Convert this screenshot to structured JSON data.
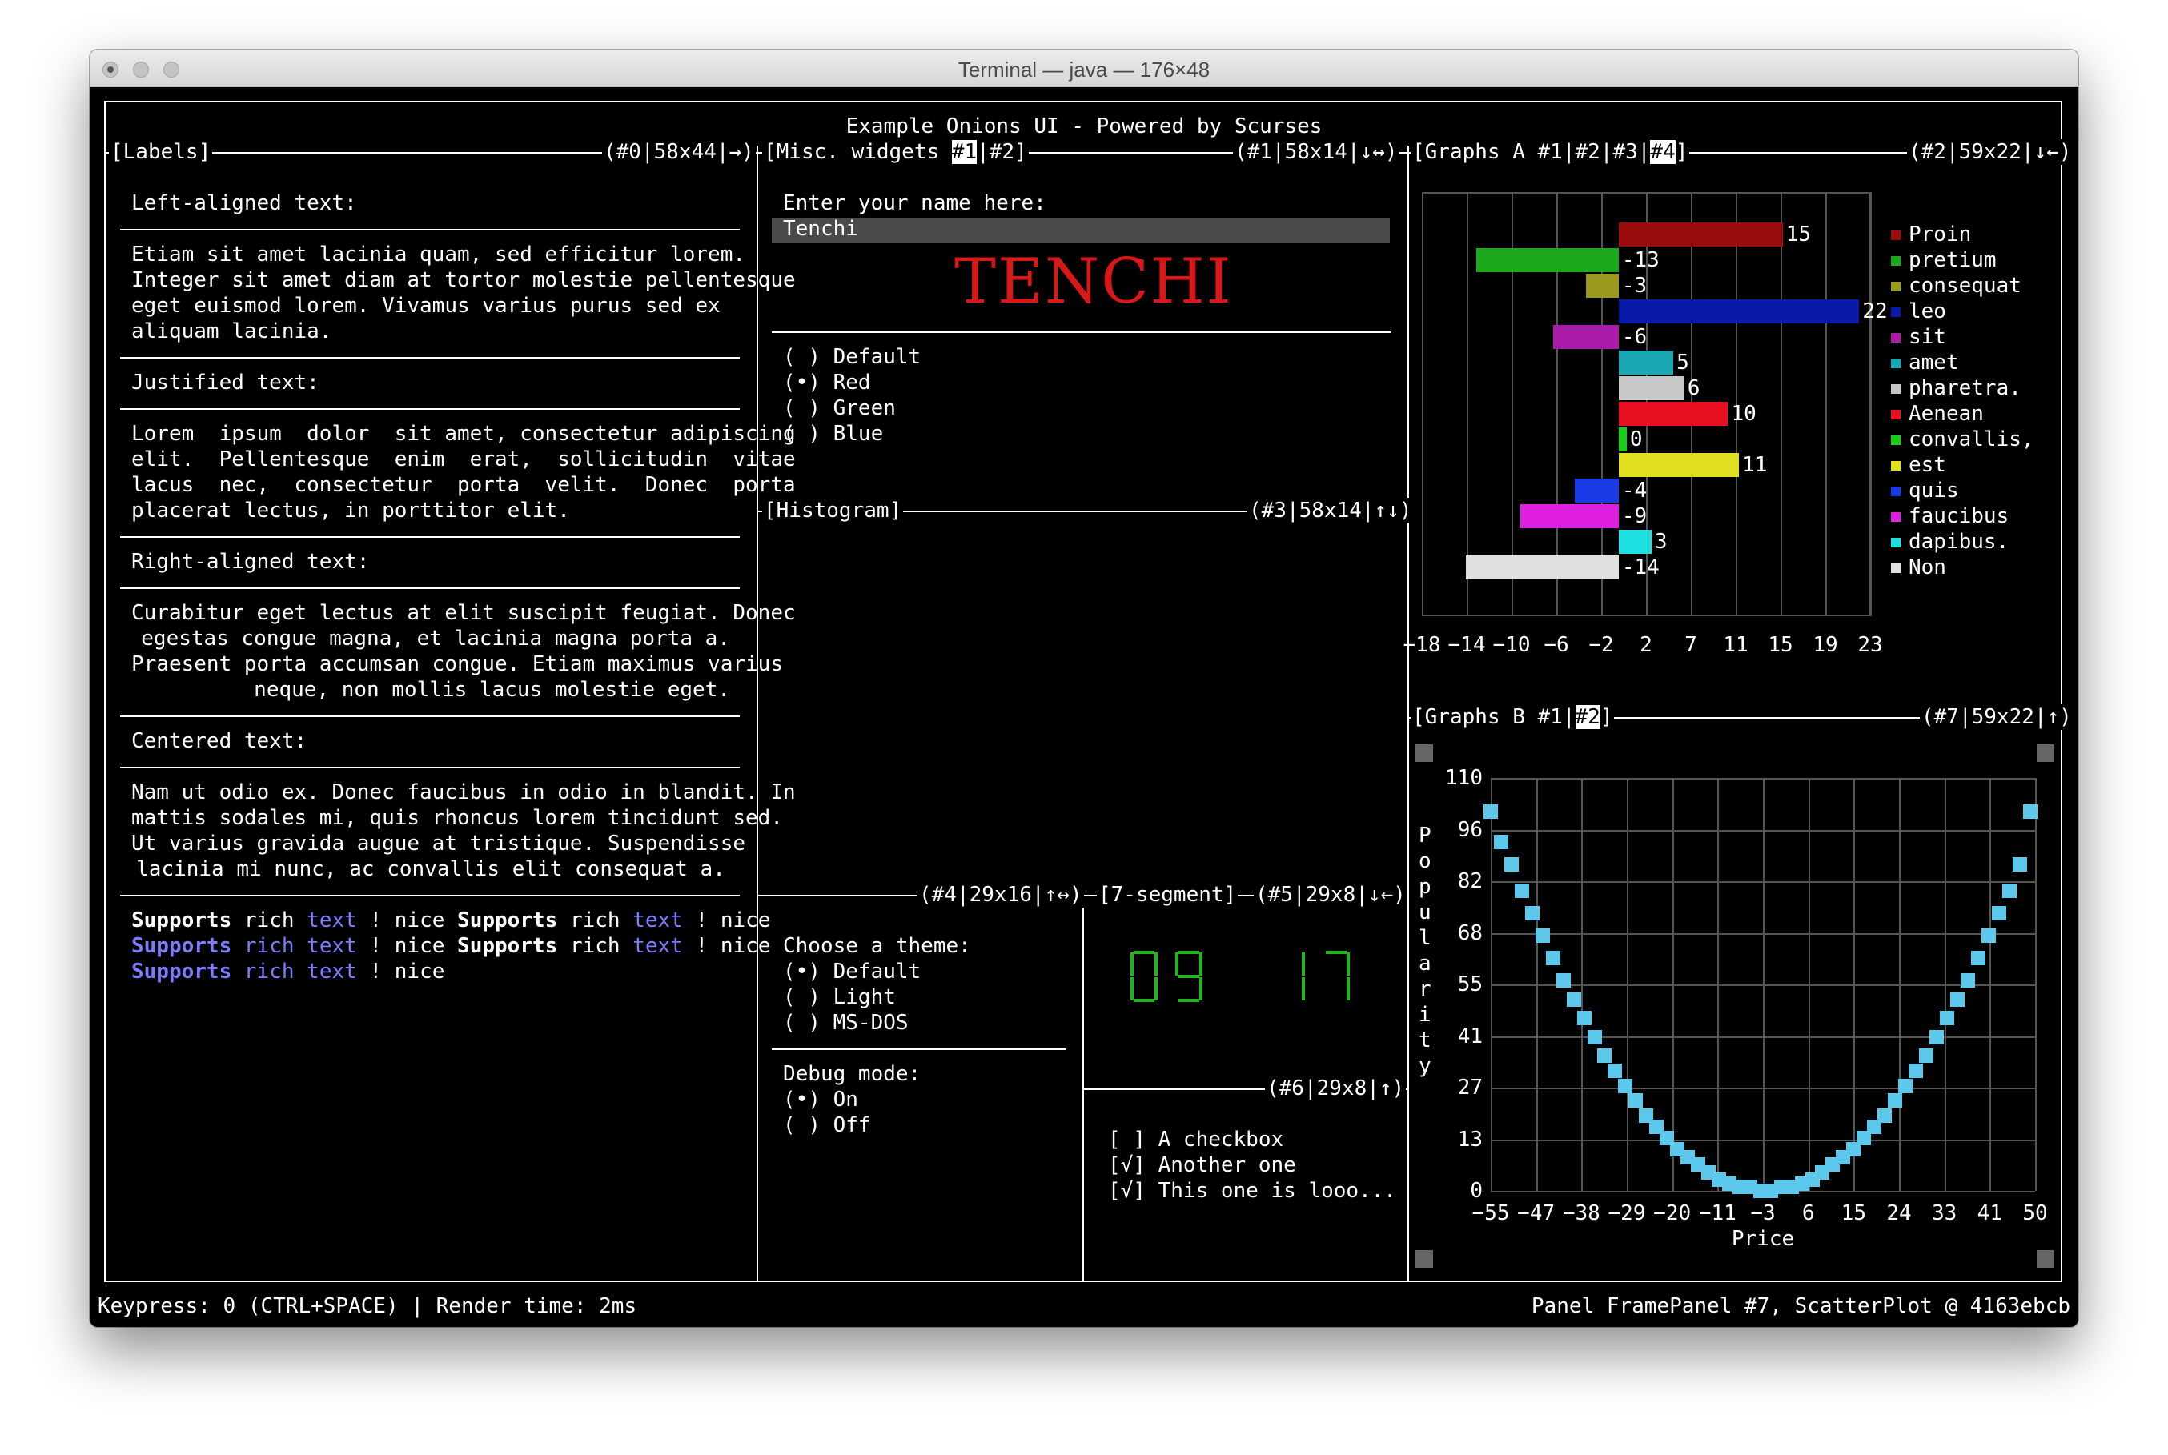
{
  "window": {
    "title": "Terminal — java — 176×48"
  },
  "app_title": "Example Onions UI - Powered by Scurses",
  "labels_panel": {
    "title": "[Labels]",
    "info": "(#0|58x44|→)",
    "left_heading": "Left-aligned text:",
    "left_lines": [
      "Etiam sit amet lacinia quam, sed efficitur lorem.",
      "Integer sit amet diam at tortor molestie pellentesque",
      "eget euismod lorem. Vivamus varius purus sed ex",
      "aliquam lacinia."
    ],
    "justified_heading": "Justified text:",
    "justified_lines": [
      "Lorem  ipsum  dolor  sit amet, consectetur adipiscing",
      "elit.  Pellentesque  enim  erat,  sollicitudin  vitae",
      "lacus  nec,  consectetur  porta  velit.  Donec  porta",
      "placerat lectus, in porttitor elit."
    ],
    "right_heading": "Right-aligned text:",
    "right_lines": [
      "Curabitur eget lectus at elit suscipit feugiat. Donec",
      "egestas congue magna, et lacinia magna porta a.",
      "Praesent porta accumsan congue. Etiam maximus varius",
      "neque, non mollis lacus molestie eget."
    ],
    "center_heading": "Centered text:",
    "center_lines": [
      "Nam ut odio ex. Donec faucibus in odio in blandit. In",
      "mattis sodales mi, quis rhoncus lorem tincidunt sed.",
      "Ut varius gravida augue at tristique. Suspendisse",
      "lacinia mi nunc, ac convallis elit consequat a."
    ],
    "rich": {
      "w1": "Supports",
      "w2": "rich",
      "w3": "text",
      "w4": "!",
      "w5": "nice"
    }
  },
  "misc_panel": {
    "title_prefix": "[Misc. widgets ",
    "tab1": "#1",
    "tab_sep": "|",
    "tab2": "#2",
    "title_suffix": "]",
    "info": "(#1|58x14|↓↔)",
    "name_prompt": "Enter your name here:",
    "name_value": "Tenchi",
    "banner_text": "TENCHI",
    "radios": [
      "( ) Default",
      "(•) Red",
      "( ) Green",
      "( ) Blue"
    ]
  },
  "histogram_panel": {
    "title": "[Histogram]",
    "info": "(#3|58x14|↑↓)"
  },
  "theme_panel": {
    "info": "(#4|29x16|↑↔)",
    "theme_heading": "Choose a theme:",
    "theme_options": [
      "(•) Default",
      "( ) Light",
      "( ) MS-DOS"
    ],
    "debug_heading": "Debug mode:",
    "debug_options": [
      "(•) On",
      "( ) Off"
    ]
  },
  "seven_seg_panel": {
    "title": "[7-segment]",
    "info": "(#5|29x8|↓←)",
    "display": "09 17"
  },
  "checkbox_panel": {
    "info": "(#6|29x8|↑)",
    "items": [
      "[ ] A checkbox",
      "[√] Another one",
      "[√] This one is looo..."
    ]
  },
  "graphs_a": {
    "title_prefix": "[Graphs A #1|#2|#3|",
    "active_tab": "#4",
    "title_suffix": "]",
    "info": "(#2|59x22|↓←)"
  },
  "graphs_b": {
    "title_prefix": "[Graphs B #1|",
    "active_tab": "#2",
    "title_suffix": "]",
    "info": "(#7|59x22|↑)"
  },
  "chart_data": [
    {
      "type": "bar",
      "orientation": "horizontal",
      "categories": [
        "Proin",
        "pretium",
        "consequat",
        "leo",
        "sit",
        "amet",
        "pharetra.",
        "Aenean",
        "convallis,",
        "est",
        "quis",
        "faucibus",
        "dapibus.",
        "Non"
      ],
      "values": [
        15,
        -13,
        -3,
        22,
        -6,
        5,
        6,
        10,
        0,
        11,
        -4,
        -9,
        3,
        -14
      ],
      "colors": [
        "#9a0b0b",
        "#1ca81c",
        "#9a9a1e",
        "#0a1aa8",
        "#a81ca8",
        "#1aa8b4",
        "#c8c8c8",
        "#e81020",
        "#1ccc1c",
        "#e0e020",
        "#1a3ae8",
        "#e020e0",
        "#1ee0e0",
        "#e0e0e0"
      ],
      "xticks": [
        "−18",
        "−14",
        "−10",
        "−6",
        "−2",
        "2",
        "7",
        "11",
        "15",
        "19",
        "23"
      ],
      "xlim": [
        -18,
        23
      ],
      "legend": "right",
      "grid": true
    },
    {
      "type": "scatter",
      "xlabel": "Price",
      "ylabel": "Popularity",
      "xticks": [
        "−55",
        "−47",
        "−38",
        "−29",
        "−20",
        "−11",
        "−3",
        "6",
        "15",
        "24",
        "33",
        "41",
        "50"
      ],
      "yticks": [
        "110",
        "96",
        "82",
        "68",
        "55",
        "41",
        "27",
        "13",
        "0"
      ],
      "xlim": [
        -55,
        50
      ],
      "ylim": [
        0,
        110
      ],
      "color": "#5bc8ec",
      "grid": true,
      "x": [
        -55,
        -53,
        -51,
        -49,
        -47,
        -45,
        -43,
        -41,
        -39,
        -37,
        -35,
        -33,
        -31,
        -29,
        -27,
        -25,
        -23,
        -21,
        -19,
        -17,
        -15,
        -13,
        -11,
        -9,
        -7,
        -5,
        -3,
        -1,
        1,
        3,
        5,
        7,
        9,
        11,
        13,
        15,
        17,
        19,
        21,
        23,
        25,
        27,
        29,
        31,
        33,
        35,
        37,
        39,
        41,
        43,
        45,
        47,
        49
      ],
      "y": [
        101,
        93,
        87,
        80,
        74,
        68,
        62,
        56,
        51,
        46,
        41,
        36,
        32,
        28,
        24,
        20,
        17,
        14,
        11,
        9,
        7,
        5,
        3,
        2,
        1,
        1,
        0,
        0,
        1,
        1,
        2,
        3,
        5,
        7,
        9,
        11,
        14,
        17,
        20,
        24,
        28,
        32,
        36,
        41,
        46,
        51,
        56,
        62,
        68,
        74,
        80,
        87,
        101
      ]
    }
  ],
  "status_bar": {
    "left": "Keypress: 0 (CTRL+SPACE) | Render time: 2ms",
    "right": "Panel FramePanel #7, ScatterPlot @ 4163ebcb"
  }
}
